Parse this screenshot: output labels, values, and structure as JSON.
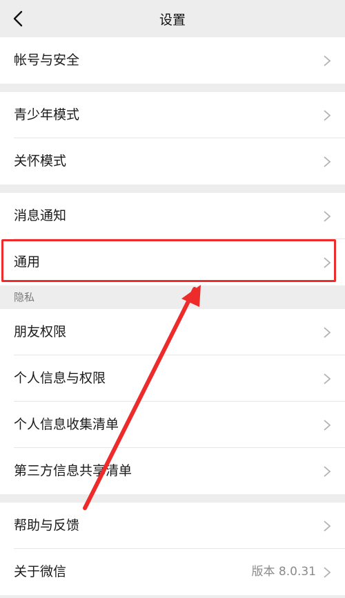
{
  "header": {
    "title": "设置"
  },
  "groups": {
    "g1": [
      "帐号与安全"
    ],
    "g2": [
      "青少年模式",
      "关怀模式"
    ],
    "g3": [
      "消息通知",
      "通用"
    ],
    "privacy_label": "隐私",
    "g4": [
      "朋友权限",
      "个人信息与权限",
      "个人信息收集清单",
      "第三方信息共享清单"
    ],
    "g5": [
      "帮助与反馈",
      "关于微信"
    ],
    "about_value": "版本 8.0.31"
  },
  "colors": {
    "highlight": "#ee2b2b",
    "background": "#ededed"
  }
}
